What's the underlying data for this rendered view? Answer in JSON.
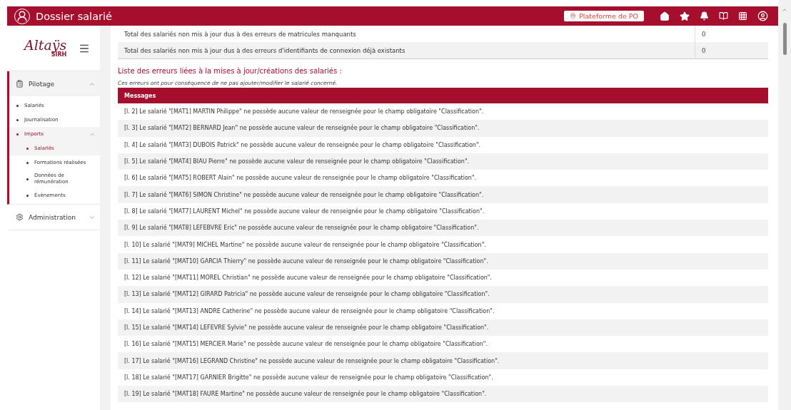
{
  "header": {
    "title": "Dossier salarié",
    "platform": "Plateforme de PO"
  },
  "logo": {
    "name": "Altaÿs",
    "tag": "SIRH"
  },
  "sidebar": {
    "sections": [
      {
        "label": "Pilotage",
        "kind": "clipboard",
        "expanded": true,
        "selected": true,
        "children": [
          {
            "label": "Salariés",
            "selected": false
          },
          {
            "label": "Journalisation",
            "selected": false
          },
          {
            "label": "Imports",
            "selected": true,
            "expanded": true,
            "children": [
              {
                "label": "Salariés",
                "selected": true
              },
              {
                "label": "Formations réalisées",
                "selected": false
              },
              {
                "label": "Données de rémunération",
                "selected": false
              },
              {
                "label": "Évènements",
                "selected": false
              }
            ]
          }
        ]
      },
      {
        "label": "Administration",
        "kind": "gear",
        "expanded": false,
        "selected": false
      }
    ]
  },
  "summary": {
    "rows": [
      {
        "label": "Total des salariés non mis à jour dus à des erreurs de matricules manquants",
        "value": "0"
      },
      {
        "label": "Total des salariés non mis à jour dus à des erreurs d'identifiants de connexion déjà existants",
        "value": "0"
      }
    ]
  },
  "errors": {
    "title": "Liste des erreurs liées à la mises à jour/créations des salariés :",
    "note": "Ces erreurs ont pour conséquence de ne pas ajouter/modifier le salarié concerné.",
    "column": "Messages",
    "rows": [
      "[l. 2] Le salarié \"[MAT1] MARTIN Philippe\" ne possède aucune valeur de renseignée pour le champ obligatoire \"Classification\".",
      "[l. 3] Le salarié \"[MAT2] BERNARD Jean\" ne possède aucune valeur de renseignée pour le champ obligatoire \"Classification\".",
      "[l. 4] Le salarié \"[MAT3] DUBOIS Patrick\" ne possède aucune valeur de renseignée pour le champ obligatoire \"Classification\".",
      "[l. 5] Le salarié \"[MAT4] BIAU Pierre\" ne possède aucune valeur de renseignée pour le champ obligatoire \"Classification\".",
      "[l. 6] Le salarié \"[MAT5] ROBERT Alain\" ne possède aucune valeur de renseignée pour le champ obligatoire \"Classification\".",
      "[l. 7] Le salarié \"[MAT6] SIMON Christine\" ne possède aucune valeur de renseignée pour le champ obligatoire \"Classification\".",
      "[l. 8] Le salarié \"[MAT7] LAURENT Michel\" ne possède aucune valeur de renseignée pour le champ obligatoire \"Classification\".",
      "[l. 9] Le salarié \"[MAT8] LEFEBVRE Eric\" ne possède aucune valeur de renseignée pour le champ obligatoire \"Classification\".",
      "[l. 10] Le salarié \"[MAT9] MICHEL Martine\" ne possède aucune valeur de renseignée pour le champ obligatoire \"Classification\".",
      "[l. 11] Le salarié \"[MAT10] GARCIA Thierry\" ne possède aucune valeur de renseignée pour le champ obligatoire \"Classification\".",
      "[l. 12] Le salarié \"[MAT11] MOREL Christian\" ne possède aucune valeur de renseignée pour le champ obligatoire \"Classification\".",
      "[l. 13] Le salarié \"[MAT12] GIRARD Patricia\" ne possède aucune valeur de renseignée pour le champ obligatoire \"Classification\".",
      "[l. 14] Le salarié \"[MAT13] ANDRE Catherine\" ne possède aucune valeur de renseignée pour le champ obligatoire \"Classification\".",
      "[l. 15] Le salarié \"[MAT14] LEFEVRE Sylvie\" ne possède aucune valeur de renseignée pour le champ obligatoire \"Classification\".",
      "[l. 16] Le salarié \"[MAT15] MERCIER Marie\" ne possède aucune valeur de renseignée pour le champ obligatoire \"Classification\".",
      "[l. 17] Le salarié \"[MAT16] LEGRAND Christine\" ne possède aucune valeur de renseignée pour le champ obligatoire \"Classification\".",
      "[l. 18] Le salarié \"[MAT17] GARNIER Brigitte\" ne possède aucune valeur de renseignée pour le champ obligatoire \"Classification\".",
      "[l. 19] Le salarié \"[MAT18] FAURE Martine\" ne possède aucune valeur de renseignée pour le champ obligatoire \"Classification\"."
    ]
  }
}
